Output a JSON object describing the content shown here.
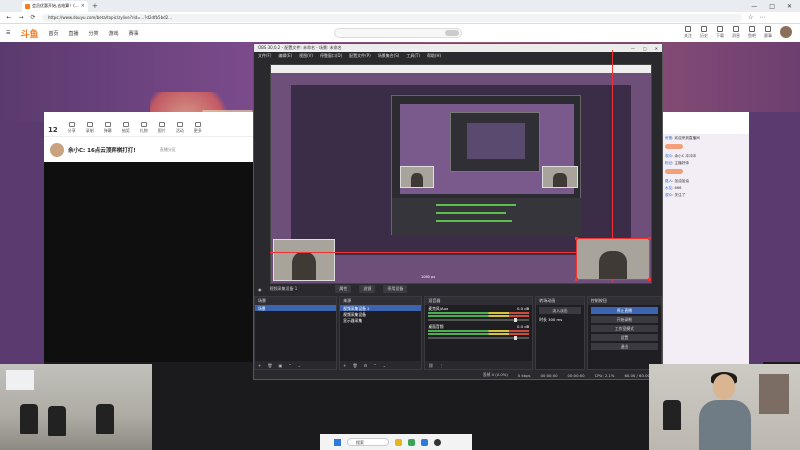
{
  "browser": {
    "tab_title": "会员优惠开始,去结算！(...",
    "url": "https://www.douyu.com/beta/topic/zylive?rid=...?d2dfb5bd2...",
    "window_controls": [
      "—",
      "□",
      "✕"
    ],
    "nav_buttons": [
      "←",
      "→",
      "⟳"
    ],
    "addr_icons": [
      "☆",
      "⋯"
    ]
  },
  "site": {
    "logo": "斗鱼",
    "nav": [
      "首页",
      "直播",
      "分类",
      "游戏",
      "赛事",
      "游戏"
    ],
    "header_items": [
      "关注",
      "历史",
      "下载",
      "消息",
      "鱼吧",
      "赛事"
    ],
    "colors": {
      "brand": "#f57c1f",
      "page_bg": "#5b3b6f"
    }
  },
  "stream_toolbar": {
    "count": "12",
    "items": [
      "分享",
      "录制",
      "弹幕",
      "抽奖",
      "礼物",
      "图片",
      "活动",
      "更多"
    ]
  },
  "streamer": {
    "name": "余小C: 16点云顶弈棋打打!",
    "badge": "直播分区"
  },
  "chat": {
    "lines": [
      {
        "user": "房管",
        "text": "欢迎来到直播间"
      },
      {
        "user": "观众",
        "text": "余小C 冲冲冲"
      },
      {
        "user": "粉丝",
        "text": "主播好帅"
      },
      {
        "user": "路人",
        "text": "加油加油"
      },
      {
        "user": "水友",
        "text": "666"
      },
      {
        "user": "观众",
        "text": "关注了"
      }
    ]
  },
  "obs": {
    "title": "OBS 30.0.2 - 配置文件: 未命名 - 场景: 未命名",
    "menu": [
      "文件(F)",
      "编辑(E)",
      "视图(V)",
      "停靠窗口(D)",
      "配置文件(P)",
      "场景集合(S)",
      "工具(T)",
      "帮助(H)"
    ],
    "preview_label": "1080 px",
    "toolbar": {
      "source_name": "视频采集设备 1",
      "buttons": [
        "属性",
        "滤镜",
        "停用设备"
      ]
    },
    "docks": {
      "scenes": {
        "title": "场景",
        "items": [
          "场景"
        ]
      },
      "sources": {
        "title": "来源",
        "items": [
          "视频采集设备 2",
          "视频采集设备",
          "显示器采集"
        ]
      },
      "mixer": {
        "title": "混音器",
        "channels": [
          {
            "name": "麦克风/Aux",
            "db": "0.0 dB"
          },
          {
            "name": "桌面音频",
            "db": "0.0 dB"
          }
        ]
      },
      "transitions": {
        "title": "转场动画",
        "type": "淡入淡出",
        "duration_label": "时长",
        "duration": "300 ms"
      },
      "controls": {
        "title": "控制按钮",
        "buttons": [
          "停止直播",
          "开始录制",
          "工作室模式",
          "设置",
          "退出"
        ]
      }
    },
    "status": [
      "丢帧 0 (0.0%)",
      "0 kbps",
      "00:00:00",
      "00:00:00",
      "CPU: 2.1%",
      "60.00 / 60.00 FPS"
    ]
  },
  "taskbar": {
    "search_label": "搜索"
  }
}
